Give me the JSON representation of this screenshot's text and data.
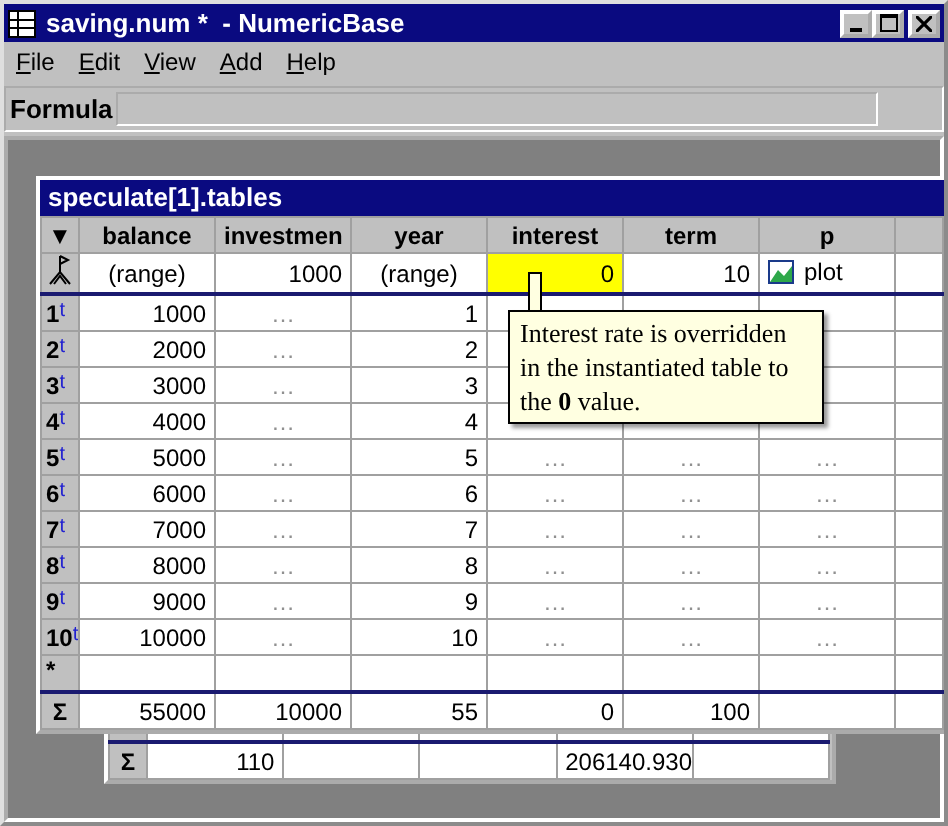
{
  "window": {
    "title": "saving.num *  - NumericBase"
  },
  "menu": [
    {
      "label": "File"
    },
    {
      "label": "Edit"
    },
    {
      "label": "View"
    },
    {
      "label": "Add"
    },
    {
      "label": "Help"
    }
  ],
  "formula_bar": {
    "label": "Formula"
  },
  "table_window": {
    "title": "speculate[1].tables",
    "header_marker": "▼",
    "columns": [
      "balance",
      "investmen",
      "year",
      "interest",
      "term",
      "p"
    ],
    "range_row": [
      {
        "text": "(range)",
        "kind": "range",
        "highlighted": false
      },
      {
        "text": "1000",
        "kind": "value",
        "highlighted": false
      },
      {
        "text": "(range)",
        "kind": "range",
        "highlighted": false
      },
      {
        "text": "0",
        "kind": "value",
        "highlighted": true
      },
      {
        "text": "10",
        "kind": "value",
        "highlighted": false
      },
      {
        "text": "plot",
        "kind": "plot",
        "highlighted": false
      }
    ],
    "rows": [
      {
        "number": "1",
        "marker": "t",
        "cells": [
          "1000",
          "…",
          "1"
        ]
      },
      {
        "number": "2",
        "marker": "t",
        "cells": [
          "2000",
          "…",
          "2"
        ]
      },
      {
        "number": "3",
        "marker": "t",
        "cells": [
          "3000",
          "…",
          "3"
        ]
      },
      {
        "number": "4",
        "marker": "t",
        "cells": [
          "4000",
          "…",
          "4"
        ]
      },
      {
        "number": "5",
        "marker": "t",
        "cells": [
          "5000",
          "…",
          "5",
          "…",
          "…",
          "…"
        ]
      },
      {
        "number": "6",
        "marker": "t",
        "cells": [
          "6000",
          "…",
          "6",
          "…",
          "…",
          "…"
        ]
      },
      {
        "number": "7",
        "marker": "t",
        "cells": [
          "7000",
          "…",
          "7",
          "…",
          "…",
          "…"
        ]
      },
      {
        "number": "8",
        "marker": "t",
        "cells": [
          "8000",
          "…",
          "8",
          "…",
          "…",
          "…"
        ]
      },
      {
        "number": "9",
        "marker": "t",
        "cells": [
          "9000",
          "…",
          "9",
          "…",
          "…",
          "…"
        ]
      },
      {
        "number": "10",
        "marker": "t",
        "cells": [
          "10000",
          "…",
          "10",
          "…",
          "…",
          "…"
        ]
      }
    ],
    "new_row_marker": "*",
    "sum_row": {
      "marker": "Σ",
      "cells": [
        "55000",
        "10000",
        "55",
        "0",
        "100"
      ]
    },
    "tooltip": "Interest rate is overridden in the instantiated table to the **0** value."
  },
  "back_window": {
    "sum_row": {
      "marker": "Σ",
      "cells": [
        "110",
        "",
        "",
        "206140.930",
        ""
      ]
    }
  }
}
